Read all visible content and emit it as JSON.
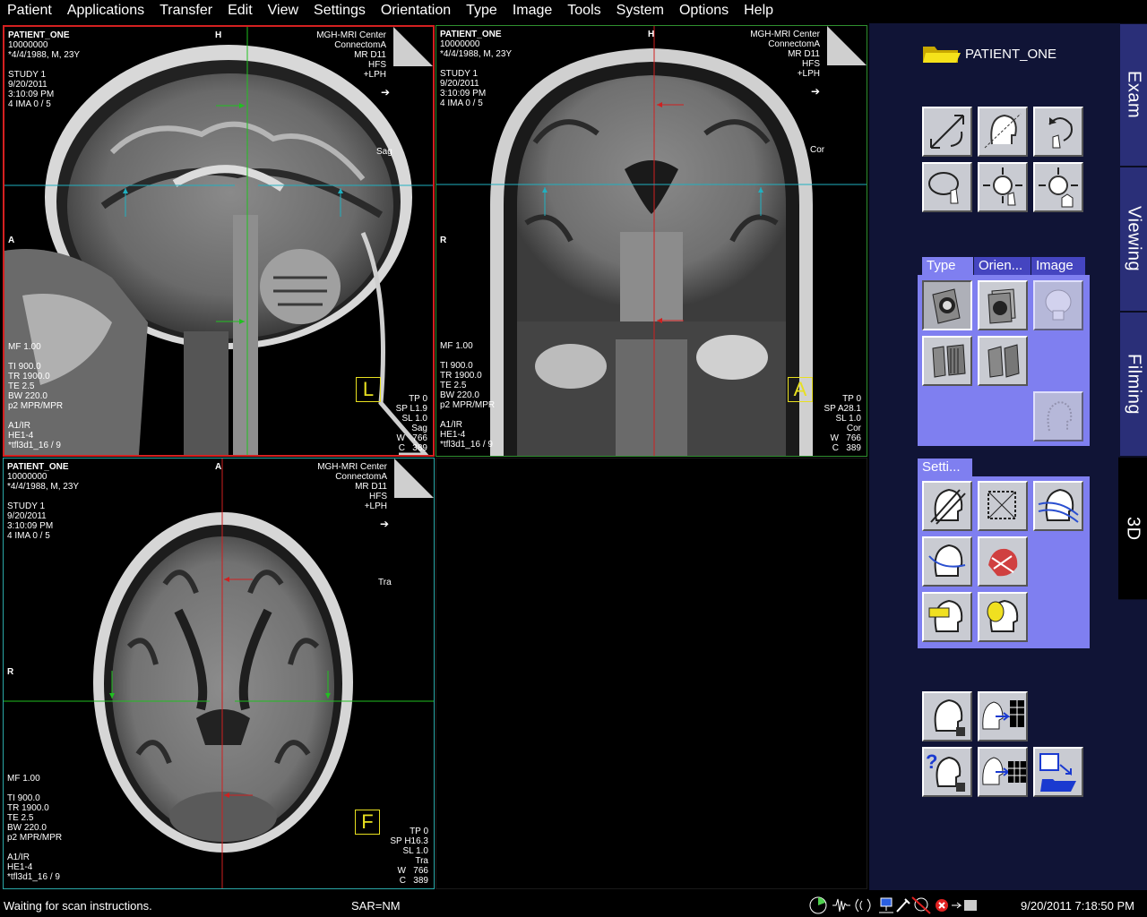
{
  "menu": [
    "Patient",
    "Applications",
    "Transfer",
    "Edit",
    "View",
    "Settings",
    "Orientation",
    "Type",
    "Image",
    "Tools",
    "System",
    "Options",
    "Help"
  ],
  "viewports": {
    "sagittal": {
      "patient_name": "PATIENT_ONE",
      "left_info": "10000000\n*4/4/1988, M, 23Y\n\nSTUDY 1\n9/20/2011\n3:10:09 PM\n4 IMA 0 / 5",
      "right_info": "MGH-MRI Center\nConnectomA\nMR D11\nHFS\n+LPH",
      "top_orient": "H",
      "left_orient": "A",
      "view_label": "Sag",
      "mag": "MF 1.00",
      "params": "TI 900.0\nTR 1900.0\nTE 2.5\nBW 220.0\np2 MPR/MPR\n\nA1/IR\nHE1-4\n*tfl3d1_16 / 9",
      "right_params": "TP 0\nSP L1.9\nSL 1.0\nSag\nW   766\nC   389",
      "marker": "L"
    },
    "coronal": {
      "patient_name": "PATIENT_ONE",
      "left_info": "10000000\n*4/4/1988, M, 23Y\n\nSTUDY 1\n9/20/2011\n3:10:09 PM\n4 IMA 0 / 5",
      "right_info": "MGH-MRI Center\nConnectomA\nMR D11\nHFS\n+LPH",
      "top_orient": "H",
      "left_orient": "R",
      "view_label": "Cor",
      "mag": "MF 1.00",
      "params": "TI 900.0\nTR 1900.0\nTE 2.5\nBW 220.0\np2 MPR/MPR\n\nA1/IR\nHE1-4\n*tfl3d1_16 / 9",
      "right_params": "TP 0\nSP A28.1\nSL 1.0\nCor\nW   766\nC   389",
      "marker": "A"
    },
    "transverse": {
      "patient_name": "PATIENT_ONE",
      "left_info": "10000000\n*4/4/1988, M, 23Y\n\nSTUDY 1\n9/20/2011\n3:10:09 PM\n4 IMA 0 / 5",
      "right_info": "MGH-MRI Center\nConnectomA\nMR D11\nHFS\n+LPH",
      "top_orient": "A",
      "left_orient": "R",
      "view_label": "Tra",
      "mag": "MF 1.00",
      "params": "TI 900.0\nTR 1900.0\nTE 2.5\nBW 220.0\np2 MPR/MPR\n\nA1/IR\nHE1-4\n*tfl3d1_16 / 9",
      "right_params": "TP 0\nSP H16.3\nSL 1.0\nTra\nW   766\nC   389",
      "marker": "F"
    }
  },
  "panel": {
    "patient_label": "PATIENT_ONE",
    "type_group_tabs": [
      "Type",
      "Orien...",
      "Image"
    ],
    "settings_group_tab": "Setti...",
    "side_tabs": [
      "Exam",
      "Viewing",
      "Filming",
      "3D"
    ]
  },
  "status": {
    "message": "Waiting for scan instructions.",
    "sar": "SAR=NM",
    "datetime": "9/20/2011 7:18:50 PM"
  },
  "colors": {
    "sagittal_border": "#d42020",
    "coronal_border": "#2f8f2f",
    "transverse_border": "#2aa7a7",
    "panel_bg": "#101436",
    "group_bg": "#7f7ff0",
    "marker": "#e8e020"
  }
}
